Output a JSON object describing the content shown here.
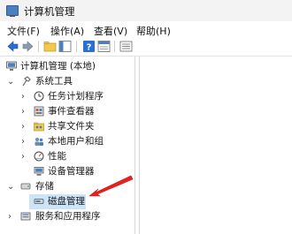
{
  "window": {
    "title": "计算机管理"
  },
  "menu": {
    "items": [
      "文件(F)",
      "操作(A)",
      "查看(V)",
      "帮助(H)"
    ]
  },
  "tree": {
    "root": "计算机管理 (本地)",
    "system_tools": "系统工具",
    "task_scheduler": "任务计划程序",
    "event_viewer": "事件查看器",
    "shared_folders": "共享文件夹",
    "local_users": "本地用户和组",
    "performance": "性能",
    "device_manager": "设备管理器",
    "storage": "存储",
    "disk_management": "磁盘管理",
    "services": "服务和应用程序"
  },
  "colors": {
    "selection": "#cce4f7",
    "arrow": "#e52222",
    "accent": "#1f6fd1"
  }
}
